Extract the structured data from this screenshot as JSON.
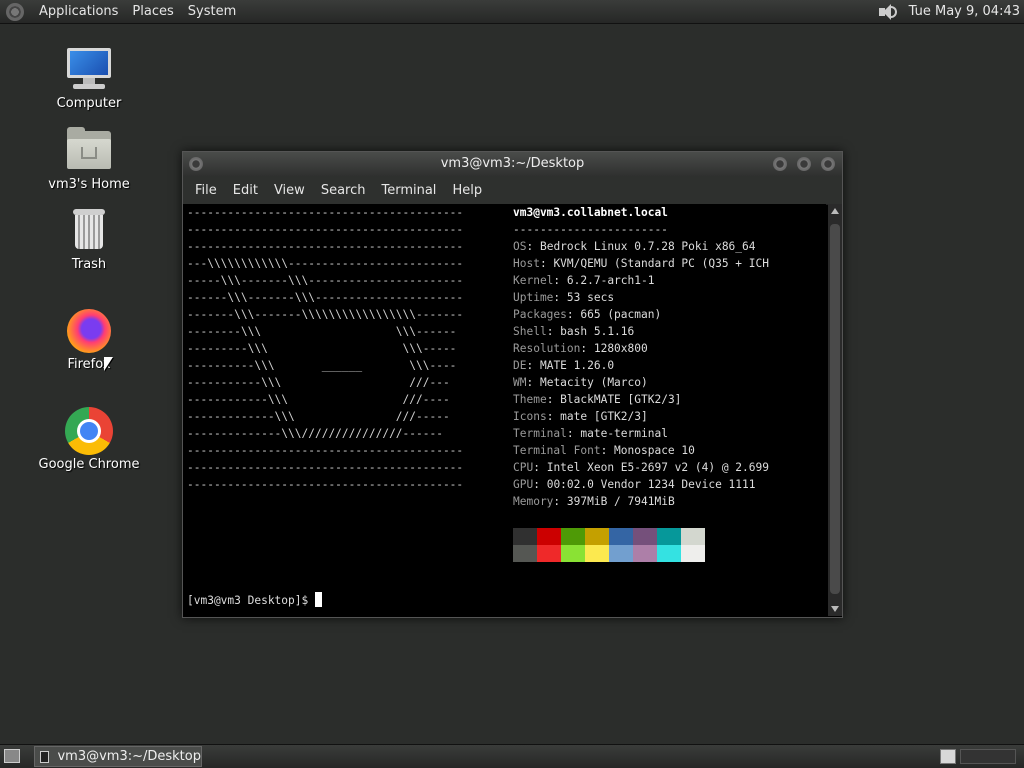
{
  "top_panel": {
    "menus": [
      "Applications",
      "Places",
      "System"
    ],
    "clock": "Tue May  9, 04:43"
  },
  "desktop": {
    "icons": [
      {
        "label": "Computer",
        "icon": "computer-icon"
      },
      {
        "label": "vm3's Home",
        "icon": "home-folder-icon"
      },
      {
        "label": "Trash",
        "icon": "trash-icon"
      },
      {
        "label": "Firefox",
        "icon": "firefox-icon"
      },
      {
        "label": "Google Chrome",
        "icon": "chrome-icon"
      }
    ]
  },
  "window": {
    "title": "vm3@vm3:~/Desktop",
    "menus": [
      "File",
      "Edit",
      "View",
      "Search",
      "Terminal",
      "Help"
    ]
  },
  "terminal": {
    "ascii_art": "-----------------------------------------\n-----------------------------------------\n-----------------------------------------\n---\\\\\\\\\\\\\\\\\\\\\\\\--------------------------\n-----\\\\\\-------\\\\\\-----------------------\n------\\\\\\-------\\\\\\----------------------\n-------\\\\\\-------\\\\\\\\\\\\\\\\\\\\\\\\\\\\\\\\\\-------\n--------\\\\\\                    \\\\\\------\n---------\\\\\\                    \\\\\\-----\n----------\\\\\\       ______       \\\\\\----\n-----------\\\\\\                   ///---\n------------\\\\\\                 ///----\n-------------\\\\\\               ///-----\n--------------\\\\\\///////////////------\n-----------------------------------------\n-----------------------------------------\n-----------------------------------------",
    "user_host": "vm3@vm3.collabnet.local",
    "separator": "-----------------------",
    "info": [
      {
        "key": "OS",
        "value": "Bedrock Linux 0.7.28 Poki x86_64"
      },
      {
        "key": "Host",
        "value": "KVM/QEMU (Standard PC (Q35 + ICH"
      },
      {
        "key": "Kernel",
        "value": "6.2.7-arch1-1"
      },
      {
        "key": "Uptime",
        "value": "53 secs"
      },
      {
        "key": "Packages",
        "value": "665 (pacman)"
      },
      {
        "key": "Shell",
        "value": "bash 5.1.16"
      },
      {
        "key": "Resolution",
        "value": "1280x800"
      },
      {
        "key": "DE",
        "value": "MATE 1.26.0"
      },
      {
        "key": "WM",
        "value": "Metacity (Marco)"
      },
      {
        "key": "Theme",
        "value": "BlackMATE [GTK2/3]"
      },
      {
        "key": "Icons",
        "value": "mate [GTK2/3]"
      },
      {
        "key": "Terminal",
        "value": "mate-terminal"
      },
      {
        "key": "Terminal Font",
        "value": "Monospace 10"
      },
      {
        "key": "CPU",
        "value": "Intel Xeon E5-2697 v2 (4) @ 2.699"
      },
      {
        "key": "GPU",
        "value": "00:02.0 Vendor 1234 Device 1111"
      },
      {
        "key": "Memory",
        "value": "397MiB / 7941MiB"
      }
    ],
    "palette": [
      "#303030",
      "#cc0000",
      "#4e9a06",
      "#c4a000",
      "#3465a4",
      "#75507b",
      "#06989a",
      "#d3d7cf",
      "#555753",
      "#ef2929",
      "#8ae234",
      "#fce94f",
      "#729fcf",
      "#ad7fa8",
      "#34e2e2",
      "#eeeeec"
    ],
    "prompt": "[vm3@vm3 Desktop]$ "
  },
  "taskbar": {
    "task_label": "vm3@vm3:~/Desktop"
  }
}
